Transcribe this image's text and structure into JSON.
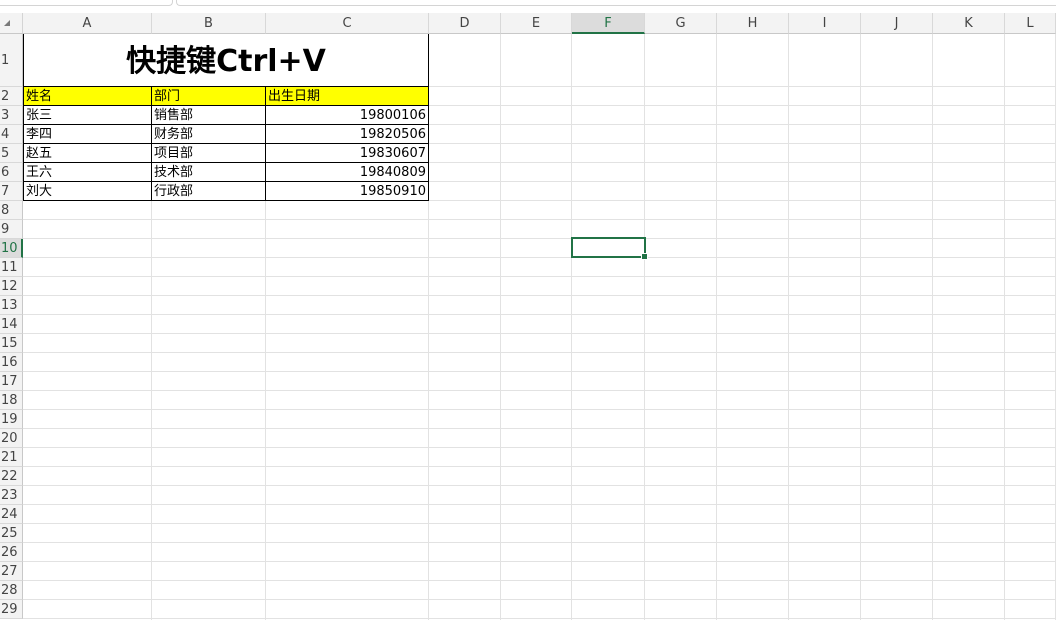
{
  "columns": [
    "A",
    "B",
    "C",
    "D",
    "E",
    "F",
    "G",
    "H",
    "I",
    "J",
    "K",
    "L"
  ],
  "active_column": "F",
  "active_row": "10",
  "rows": [
    "1",
    "2",
    "3",
    "4",
    "5",
    "6",
    "7",
    "8",
    "9",
    "10",
    "11",
    "12",
    "13",
    "14",
    "15",
    "16",
    "17",
    "18",
    "19",
    "20",
    "21",
    "22",
    "23",
    "24",
    "25",
    "26",
    "27",
    "28",
    "29"
  ],
  "sheet": {
    "title": "快捷键Ctrl+V",
    "headers": [
      "姓名",
      "部门",
      "出生日期"
    ],
    "data": [
      [
        "张三",
        "销售部",
        "19800106"
      ],
      [
        "李四",
        "财务部",
        "19820506"
      ],
      [
        "赵五",
        "项目部",
        "19830607"
      ],
      [
        "王六",
        "技术部",
        "19840809"
      ],
      [
        "刘大",
        "行政部",
        "19850910"
      ]
    ]
  },
  "colors": {
    "header_fill": "#ffff00",
    "accent": "#217346"
  }
}
